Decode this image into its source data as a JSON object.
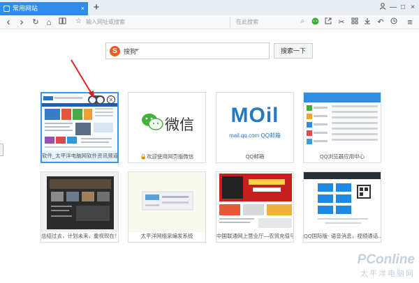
{
  "tab": {
    "title": "常用网站",
    "close": "×"
  },
  "newtab_label": "+",
  "window": {
    "user_icon": "user-icon",
    "min": "—",
    "max": "□",
    "close": "×"
  },
  "toolbar": {
    "back": "‹",
    "forward": "›",
    "refresh": "↻",
    "home": "⌂",
    "address_placeholder": "输入网址或搜索",
    "search_placeholder": "在此搜索",
    "menu": "≡"
  },
  "search": {
    "engine_name": "搜狗",
    "engine_logo": "S",
    "button_label": "搜索一下"
  },
  "tiles": [
    {
      "caption": "软件_太平洋电脑网软件资讯频道"
    },
    {
      "caption": "欢迎使用网页版微信",
      "logo_text": "微信"
    },
    {
      "caption": "QQ邮箱",
      "logo_text": "MOil",
      "logo_sub": "mail.qq.com QQ邮箱"
    },
    {
      "caption": "QQ浏览器应用中心"
    },
    {
      "caption": "总结过去，计划未来，重视现在！ [..."
    },
    {
      "caption": "太平洋网络采编发系统"
    },
    {
      "caption": "中国联通网上营业厅—农贸充值与..."
    },
    {
      "caption": "QQ国际版- 语音消息，视频通话..."
    }
  ],
  "watermark": {
    "line1": "PConline",
    "line2": "太平洋电脑网"
  },
  "colors": {
    "accent": "#2f8ce8",
    "annotation_arrow": "#e02020"
  }
}
